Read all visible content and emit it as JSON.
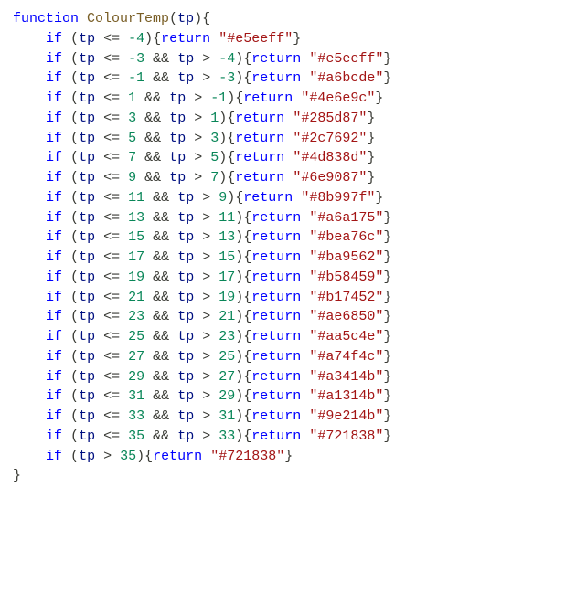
{
  "code": {
    "kw_function": "function",
    "fn_name": "ColourTemp",
    "param": "tp",
    "kw_if": "if",
    "kw_return": "return",
    "op_lte": "<=",
    "op_gt": ">",
    "op_and": "&&",
    "lines": [
      {
        "type": "single_lte_ret",
        "upper": "-4",
        "ret": "\"#e5eeff\""
      },
      {
        "type": "range",
        "upper": "-3",
        "lower": "-4",
        "ret": "\"#e5eeff\""
      },
      {
        "type": "range",
        "upper": "-1",
        "lower": "-3",
        "ret": "\"#a6bcde\""
      },
      {
        "type": "range",
        "upper": "1",
        "lower": "-1",
        "ret": "\"#4e6e9c\""
      },
      {
        "type": "range",
        "upper": "3",
        "lower": "1",
        "ret": "\"#285d87\""
      },
      {
        "type": "range",
        "upper": "5",
        "lower": "3",
        "ret": "\"#2c7692\""
      },
      {
        "type": "range",
        "upper": "7",
        "lower": "5",
        "ret": "\"#4d838d\""
      },
      {
        "type": "range",
        "upper": "9",
        "lower": "7",
        "ret": "\"#6e9087\""
      },
      {
        "type": "range",
        "upper": "11",
        "lower": "9",
        "ret": "\"#8b997f\""
      },
      {
        "type": "range",
        "upper": "13",
        "lower": "11",
        "ret": "\"#a6a175\""
      },
      {
        "type": "range",
        "upper": "15",
        "lower": "13",
        "ret": "\"#bea76c\""
      },
      {
        "type": "range",
        "upper": "17",
        "lower": "15",
        "ret": "\"#ba9562\""
      },
      {
        "type": "range",
        "upper": "19",
        "lower": "17",
        "ret": "\"#b58459\""
      },
      {
        "type": "range",
        "upper": "21",
        "lower": "19",
        "ret": "\"#b17452\""
      },
      {
        "type": "range",
        "upper": "23",
        "lower": "21",
        "ret": "\"#ae6850\""
      },
      {
        "type": "range",
        "upper": "25",
        "lower": "23",
        "ret": "\"#aa5c4e\""
      },
      {
        "type": "range",
        "upper": "27",
        "lower": "25",
        "ret": "\"#a74f4c\""
      },
      {
        "type": "range",
        "upper": "29",
        "lower": "27",
        "ret": "\"#a3414b\""
      },
      {
        "type": "range",
        "upper": "31",
        "lower": "29",
        "ret": "\"#a1314b\""
      },
      {
        "type": "range",
        "upper": "33",
        "lower": "31",
        "ret": "\"#9e214b\""
      },
      {
        "type": "range",
        "upper": "35",
        "lower": "33",
        "ret": "\"#721838\""
      },
      {
        "type": "single_gt_ret",
        "lower": "35",
        "ret": "\"#721838\""
      }
    ]
  }
}
